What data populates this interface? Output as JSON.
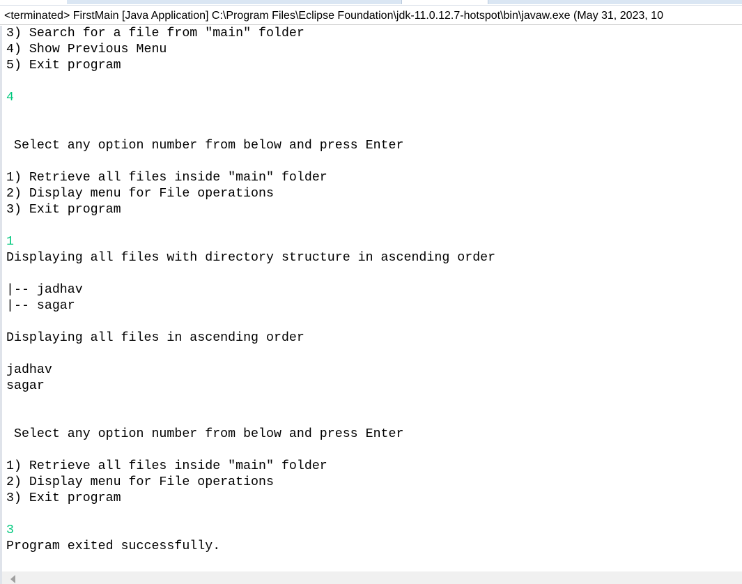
{
  "title": "<terminated> FirstMain [Java Application] C:\\Program Files\\Eclipse Foundation\\jdk-11.0.12.7-hotspot\\bin\\javaw.exe (May 31, 2023, 10",
  "colors": {
    "input": "#00c87d",
    "output": "#000000"
  },
  "console": [
    {
      "text": "3) Search for a file from \"main\" folder",
      "type": "output"
    },
    {
      "text": "4) Show Previous Menu",
      "type": "output"
    },
    {
      "text": "5) Exit program",
      "type": "output"
    },
    {
      "text": "",
      "type": "output"
    },
    {
      "text": "4",
      "type": "input"
    },
    {
      "text": "",
      "type": "output"
    },
    {
      "text": "",
      "type": "output"
    },
    {
      "text": " Select any option number from below and press Enter",
      "type": "output"
    },
    {
      "text": "",
      "type": "output"
    },
    {
      "text": "1) Retrieve all files inside \"main\" folder",
      "type": "output"
    },
    {
      "text": "2) Display menu for File operations",
      "type": "output"
    },
    {
      "text": "3) Exit program",
      "type": "output"
    },
    {
      "text": "",
      "type": "output"
    },
    {
      "text": "1",
      "type": "input"
    },
    {
      "text": "Displaying all files with directory structure in ascending order",
      "type": "output"
    },
    {
      "text": "",
      "type": "output"
    },
    {
      "text": "|-- jadhav",
      "type": "output"
    },
    {
      "text": "|-- sagar",
      "type": "output"
    },
    {
      "text": "",
      "type": "output"
    },
    {
      "text": "Displaying all files in ascending order",
      "type": "output"
    },
    {
      "text": "",
      "type": "output"
    },
    {
      "text": "jadhav",
      "type": "output"
    },
    {
      "text": "sagar",
      "type": "output"
    },
    {
      "text": "",
      "type": "output"
    },
    {
      "text": "",
      "type": "output"
    },
    {
      "text": " Select any option number from below and press Enter",
      "type": "output"
    },
    {
      "text": "",
      "type": "output"
    },
    {
      "text": "1) Retrieve all files inside \"main\" folder",
      "type": "output"
    },
    {
      "text": "2) Display menu for File operations",
      "type": "output"
    },
    {
      "text": "3) Exit program",
      "type": "output"
    },
    {
      "text": "",
      "type": "output"
    },
    {
      "text": "3",
      "type": "input"
    },
    {
      "text": "Program exited successfully.",
      "type": "output"
    }
  ]
}
